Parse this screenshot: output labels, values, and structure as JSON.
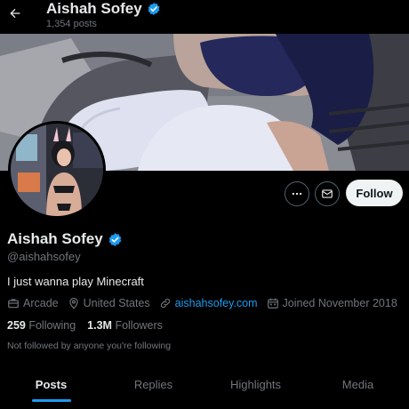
{
  "header": {
    "name": "Aishah Sofey",
    "post_count": "1,354 posts"
  },
  "profile": {
    "name": "Aishah Sofey",
    "handle": "@aishahsofey",
    "bio": "I just wanna play Minecraft",
    "category": "Arcade",
    "location": "United States",
    "website": "aishahsofey.com",
    "joined": "Joined November 2018",
    "following_count": "259",
    "following_label": "Following",
    "followers_count": "1.3M",
    "followers_label": "Followers",
    "not_followed_text": "Not followed by anyone you're following"
  },
  "actions": {
    "follow_label": "Follow"
  },
  "tabs": [
    {
      "label": "Posts",
      "active": true
    },
    {
      "label": "Replies",
      "active": false
    },
    {
      "label": "Highlights",
      "active": false
    },
    {
      "label": "Media",
      "active": false
    }
  ],
  "colors": {
    "accent": "#1d9bf0",
    "background": "#000000",
    "secondary_text": "#71767b",
    "primary_text": "#e7e9ea"
  },
  "icons": [
    "back-arrow-icon",
    "verified-badge-icon",
    "more-icon",
    "message-icon",
    "briefcase-icon",
    "location-pin-icon",
    "link-icon",
    "calendar-icon"
  ]
}
